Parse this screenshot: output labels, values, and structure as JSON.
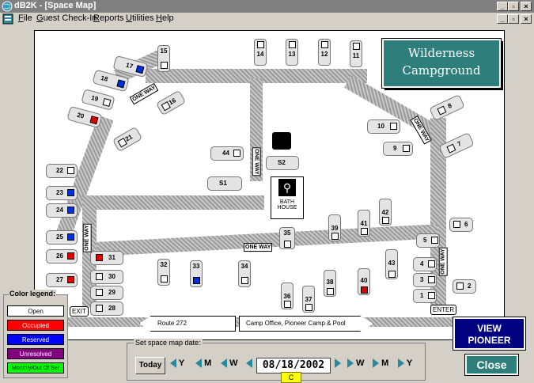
{
  "window": {
    "title": "dB2K - [Space Map]"
  },
  "menu": [
    {
      "label": "File",
      "key": "F",
      "rest": "ile"
    },
    {
      "label": "Guest Check-In",
      "key": "G",
      "rest": "uest Check-In"
    },
    {
      "label": "Reports",
      "key": "R",
      "rest": "eports"
    },
    {
      "label": "Utilities",
      "key": "U",
      "rest": "tilities"
    },
    {
      "label": "Help",
      "key": "H",
      "rest": "elp"
    }
  ],
  "map": {
    "logo_line1": "Wilderness",
    "logo_line2": "Campground",
    "bath_label": "BATH HOUSE",
    "exit_label": "EXIT",
    "enter_label": "ENTER",
    "route_label": "Route 272",
    "office_label": "Camp Office, Pioneer Camp & Pool",
    "one_way": "ONE WAY",
    "sites": {
      "s1": "1",
      "s2": "2",
      "s3": "3",
      "s4": "4",
      "s5": "5",
      "s6": "6",
      "s7": "7",
      "s8": "8",
      "s9": "9",
      "s10": "10",
      "s11": "11",
      "s12": "12",
      "s13": "13",
      "s14": "14",
      "s15": "15",
      "s16": "16",
      "s17": "17",
      "s18": "18",
      "s19": "19",
      "s20": "20",
      "s21": "21",
      "s22": "22",
      "s23": "23",
      "s24": "24",
      "s25": "25",
      "s26": "26",
      "s27": "27",
      "s28": "28",
      "s29": "29",
      "s30": "30",
      "s31": "31",
      "s32": "32",
      "s33": "33",
      "s34": "34",
      "s35": "35",
      "s36": "36",
      "s37": "37",
      "s38": "38",
      "s39": "39",
      "s40": "40",
      "s41": "41",
      "s42": "42",
      "s43": "43",
      "s44": "44",
      "sS1": "S1",
      "sS2": "S2"
    }
  },
  "legend": {
    "title": "Color legend:",
    "open": "Open",
    "occupied": "Occupied",
    "reserved": "Reserved",
    "unresolved": "Unresolved",
    "monthly": "Monthly/Out Of Ser",
    "colors": {
      "open": "#ffffff",
      "occupied": "#ff0000",
      "reserved": "#0000ff",
      "unresolved": "#800080",
      "monthly": "#00ff00"
    }
  },
  "date_panel": {
    "title": "Set space map date:",
    "today": "Today",
    "y": "Y",
    "m": "M",
    "w": "W",
    "date": "08/18/2002",
    "c": "C"
  },
  "buttons": {
    "view_pioneer": "VIEW PIONEER",
    "close": "Close"
  }
}
